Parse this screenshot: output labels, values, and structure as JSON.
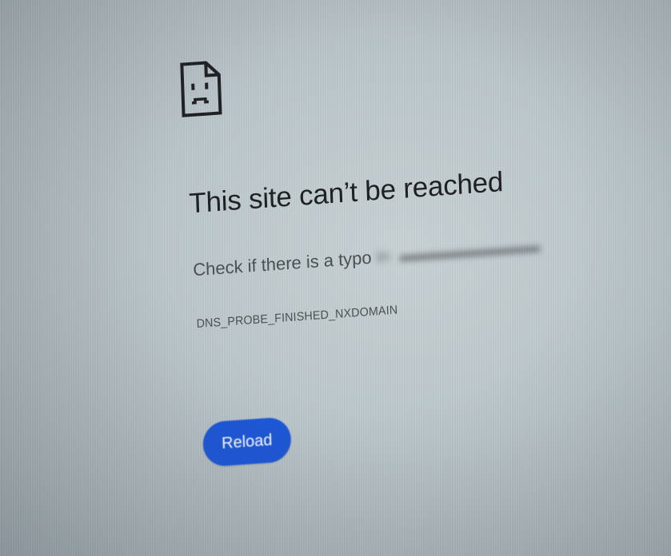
{
  "error_page": {
    "title": "This site can’t be reached",
    "hint_text": "Check if there is a typo",
    "hint_blurred": "in ",
    "error_code": "DNS_PROBE_FINISHED_NXDOMAIN",
    "reload_label": "Reload",
    "icon": "sad-document-icon"
  },
  "colors": {
    "button": "#1d57d6",
    "button_text": "#ffffff",
    "title": "#202124",
    "body_text": "#4a4f52",
    "background": "#c2cccf"
  }
}
